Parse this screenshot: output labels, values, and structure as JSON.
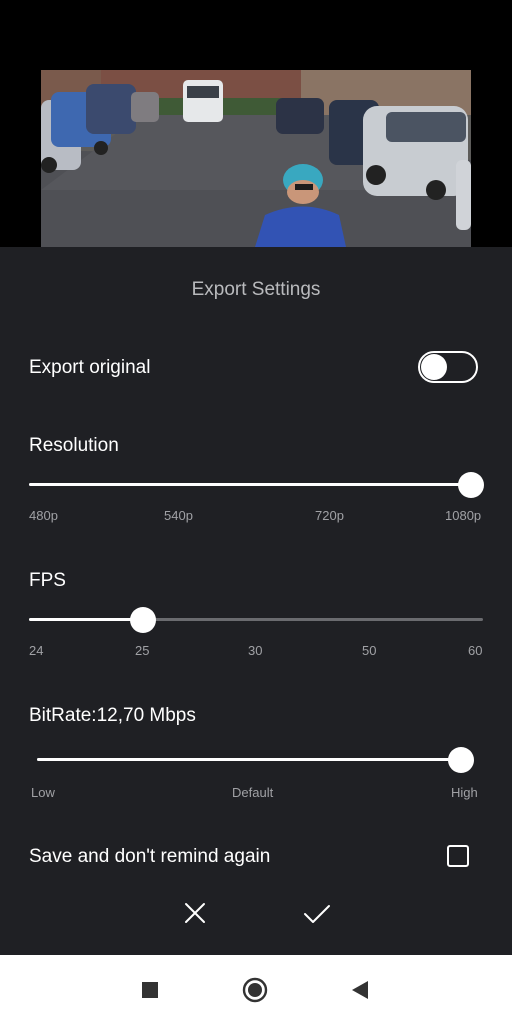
{
  "dialog": {
    "title": "Export Settings",
    "export_original": {
      "label": "Export original",
      "on": false
    },
    "resolution": {
      "label": "Resolution",
      "ticks": [
        "480p",
        "540p",
        "720p",
        "1080p"
      ],
      "selected": "1080p",
      "fraction": 1.0
    },
    "fps": {
      "label": "FPS",
      "ticks": [
        "24",
        "25",
        "30",
        "50",
        "60"
      ],
      "selected": "25",
      "fraction": 0.25
    },
    "bitrate": {
      "label": "BitRate:12,70 Mbps",
      "ticks": [
        "Low",
        "Default",
        "High"
      ],
      "fraction": 1.0
    },
    "remember": {
      "label": "Save and don't remind again",
      "checked": false
    },
    "actions": {
      "cancel_icon": "close-icon",
      "confirm_icon": "check-icon"
    }
  },
  "navbar": {
    "icons": [
      "recents-square-icon",
      "home-circle-icon",
      "back-triangle-icon"
    ]
  },
  "colors": {
    "sheet_bg": "#1f2024",
    "track_inactive": "#6a6b6f",
    "accent": "#ffffff"
  }
}
